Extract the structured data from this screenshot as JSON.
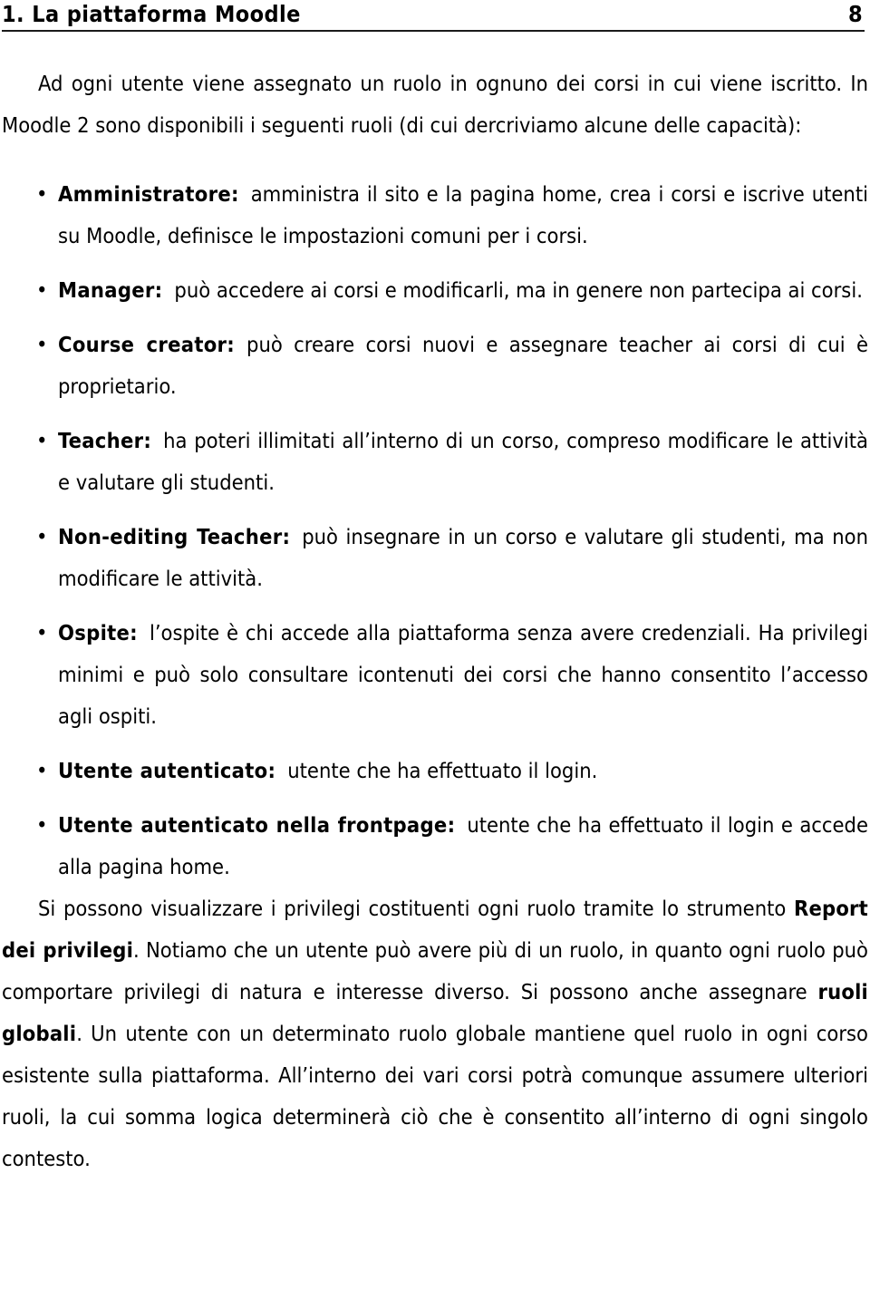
{
  "header": {
    "chapter_title": "1. La piattaforma Moodle",
    "page_number": "8"
  },
  "intro": {
    "paragraph": "Ad ogni utente viene assegnato un ruolo in ognuno dei corsi in cui viene iscritto. In Moodle 2 sono disponibili i seguenti ruoli (di cui dercriviamo alcune delle capacità):"
  },
  "roles": [
    {
      "bullet_glyph": "•",
      "term": "Amministratore:",
      "description": "amministra il sito e la pagina home, crea i corsi e iscrive utenti su Moodle, definisce le impostazioni comuni per i corsi."
    },
    {
      "bullet_glyph": "•",
      "term": "Manager:",
      "description": "può accedere ai corsi e modificarli, ma in genere non partecipa ai corsi."
    },
    {
      "bullet_glyph": "•",
      "term": "Course creator:",
      "description": "può creare corsi nuovi e assegnare teacher ai corsi di cui è proprietario."
    },
    {
      "bullet_glyph": "•",
      "term": "Teacher:",
      "description": "ha poteri illimitati all’interno di un corso, compreso modificare le attività e valutare gli studenti."
    },
    {
      "bullet_glyph": "•",
      "term": "Non-editing Teacher:",
      "description": "può insegnare in un corso e valutare gli studenti, ma non modificare le attività."
    },
    {
      "bullet_glyph": "•",
      "term": "Ospite:",
      "description": "l’ospite è chi accede alla piattaforma senza avere credenziali. Ha privilegi minimi e può solo consultare icontenuti dei corsi che hanno consentito l’accesso agli ospiti."
    },
    {
      "bullet_glyph": "•",
      "term": "Utente autenticato:",
      "description": "utente che ha effettuato il login."
    },
    {
      "bullet_glyph": "•",
      "term": "Utente autenticato nella frontpage:",
      "description": "utente che ha effettuato il login e accede alla pagina home."
    }
  ],
  "closing": {
    "part1": "Si possono visualizzare i privilegi costituenti ogni ruolo tramite lo strumento ",
    "bold1": "Report dei privilegi",
    "part2": ". Notiamo che un utente può avere più di un ruolo, in quanto ogni ruolo può comportare privilegi di natura e interesse diverso. Si possono anche assegnare ",
    "bold2": "ruoli globali",
    "part3": ". Un utente con un determinato ruolo globale mantiene quel ruolo in ogni corso esistente sulla piattaforma. All’interno dei vari corsi potrà comunque assumere ulteriori ruoli, la cui somma logica determinerà ciò che è consentito all’interno di ogni singolo contesto."
  }
}
